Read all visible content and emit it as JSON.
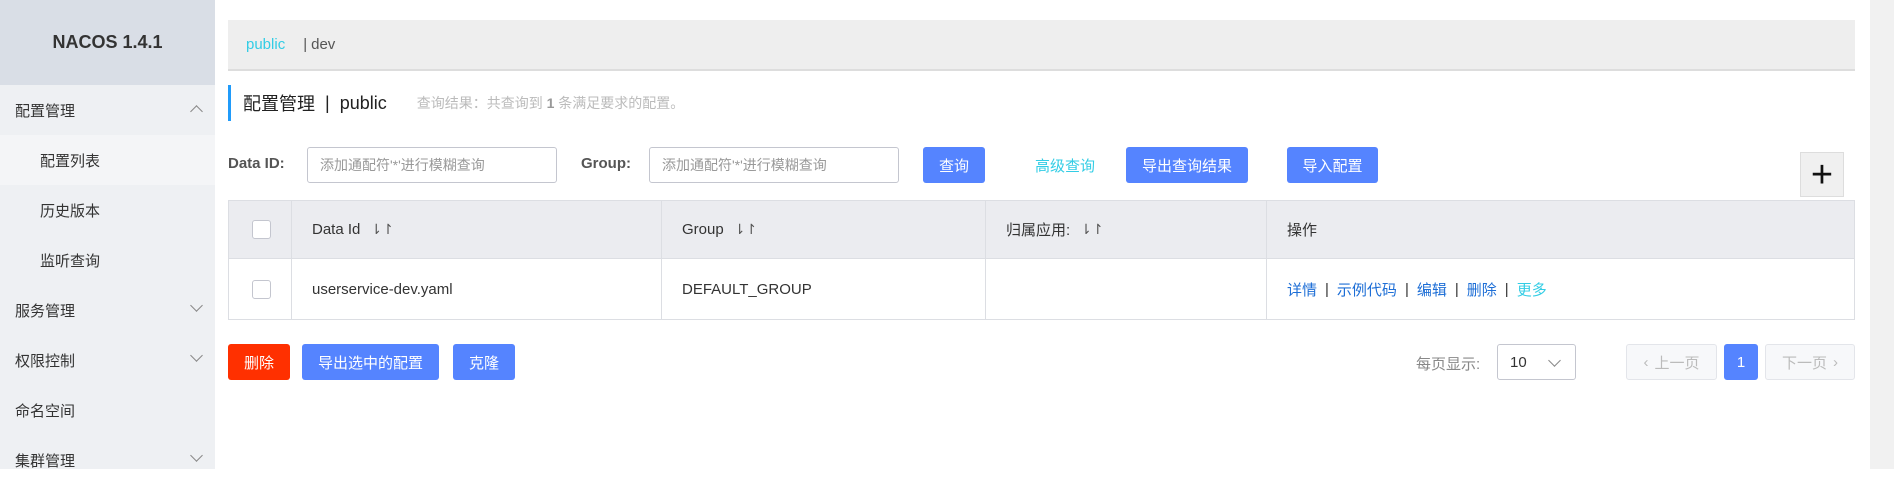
{
  "app": {
    "title": "NACOS 1.4.1"
  },
  "sidebar": {
    "items": [
      {
        "label": "配置管理",
        "expanded": true
      },
      {
        "label": "配置列表",
        "selected": true
      },
      {
        "label": "历史版本"
      },
      {
        "label": "监听查询"
      },
      {
        "label": "服务管理"
      },
      {
        "label": "权限控制"
      },
      {
        "label": "命名空间"
      },
      {
        "label": "集群管理"
      }
    ]
  },
  "namespaces": {
    "active": "public",
    "separator": "|",
    "other": "dev"
  },
  "header": {
    "title": "配置管理",
    "separator": "|",
    "namespace": "public",
    "result_prefix": "查询结果：共查询到",
    "result_count": "1",
    "result_suffix": "条满足要求的配置。"
  },
  "search": {
    "dataid_label": "Data ID:",
    "dataid_placeholder": "添加通配符'*'进行模糊查询",
    "group_label": "Group:",
    "group_placeholder": "添加通配符'*'进行模糊查询",
    "query_btn": "查询",
    "advanced": "高级查询",
    "export_btn": "导出查询结果",
    "import_btn": "导入配置",
    "add_btn": "+"
  },
  "table": {
    "headers": [
      "Data Id",
      "Group",
      "归属应用:",
      "操作"
    ],
    "sort_icon": "⇂↾",
    "rows": [
      {
        "data_id": "userservice-dev.yaml",
        "group": "DEFAULT_GROUP",
        "app": "",
        "actions": [
          "详情",
          "示例代码",
          "编辑",
          "删除",
          "更多"
        ]
      }
    ]
  },
  "footer": {
    "delete_btn": "删除",
    "export_selected_btn": "导出选中的配置",
    "clone_btn": "克隆",
    "page_size_label": "每页显示:",
    "page_size": "10",
    "prev": "上一页",
    "page": "1",
    "next": "下一页"
  }
}
